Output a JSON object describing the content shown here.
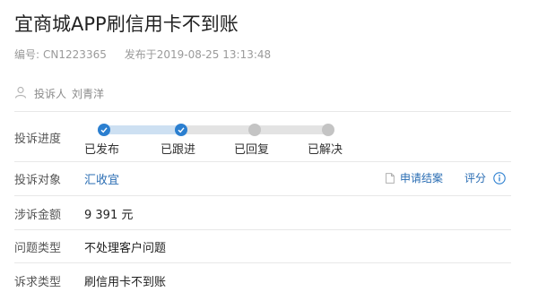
{
  "title": "宜商城APP刷信用卡不到账",
  "meta": {
    "id_label": "编号:",
    "id_value": "CN1223365",
    "published_label": "发布于",
    "published_value": "2019-08-25 13:13:48"
  },
  "complainant": {
    "label": "投诉人",
    "name": "刘青洋"
  },
  "progress": {
    "label": "投诉进度",
    "steps": [
      {
        "label": "已发布",
        "done": true
      },
      {
        "label": "已跟进",
        "done": true
      },
      {
        "label": "已回复",
        "done": false
      },
      {
        "label": "已解决",
        "done": false
      }
    ]
  },
  "target": {
    "label": "投诉对象",
    "value": "汇收宜",
    "apply_close": "申请结案",
    "rate": "评分"
  },
  "amount": {
    "label": "涉诉金额",
    "value": "9 391 元"
  },
  "issue_type": {
    "label": "问题类型",
    "value": "不处理客户问题"
  },
  "demand_type": {
    "label": "诉求类型",
    "value": "刷信用卡不到账"
  },
  "colors": {
    "accent": "#2b7fd0",
    "link": "#2a6db3",
    "progress_done_track": "#cde0f2",
    "progress_todo": "#c4c4c4"
  },
  "icons": {
    "avatar": "person-icon",
    "step_done": "checkmark-icon",
    "apply_close": "document-icon",
    "rate_info": "info-icon"
  }
}
